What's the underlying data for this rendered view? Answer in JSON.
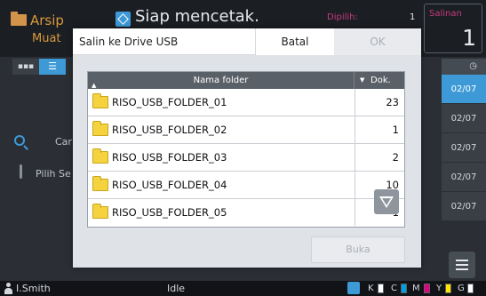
{
  "app": {
    "archive_tab": {
      "title": "Arsip",
      "sub": "Muat"
    },
    "status_text": "Siap mencetak.",
    "selected_label": "Dipilih:",
    "selected_count": "1",
    "copies_label": "Salinan",
    "copies_value": "1",
    "view_list_label": "▪▪▪",
    "view_detail_label": "☰",
    "search_label": "Car",
    "select_label": "Pilih Se",
    "date_header": "◷",
    "dates": [
      "02/07",
      "02/07",
      "02/07",
      "02/07",
      "02/07"
    ],
    "selected_date_index": 0
  },
  "statusbar": {
    "user": "I.Smith",
    "state": "Idle",
    "inks": [
      "K",
      "C",
      "M",
      "Y",
      "G"
    ],
    "ink_colors": [
      "#ffffff",
      "#00a0e0",
      "#e6007e",
      "#ffe600",
      "#ffffff"
    ]
  },
  "dialog": {
    "title": "Salin ke Drive USB",
    "cancel_label": "Batal",
    "ok_label": "OK",
    "table": {
      "col_name": "Nama folder",
      "col_docs": "Dok.",
      "rows": [
        {
          "name": "RISO_USB_FOLDER_01",
          "count": "23"
        },
        {
          "name": "RISO_USB_FOLDER_02",
          "count": "1"
        },
        {
          "name": "RISO_USB_FOLDER_03",
          "count": "2"
        },
        {
          "name": "RISO_USB_FOLDER_04",
          "count": "10"
        },
        {
          "name": "RISO_USB_FOLDER_05",
          "count": "1"
        }
      ]
    },
    "open_label": "Buka"
  }
}
